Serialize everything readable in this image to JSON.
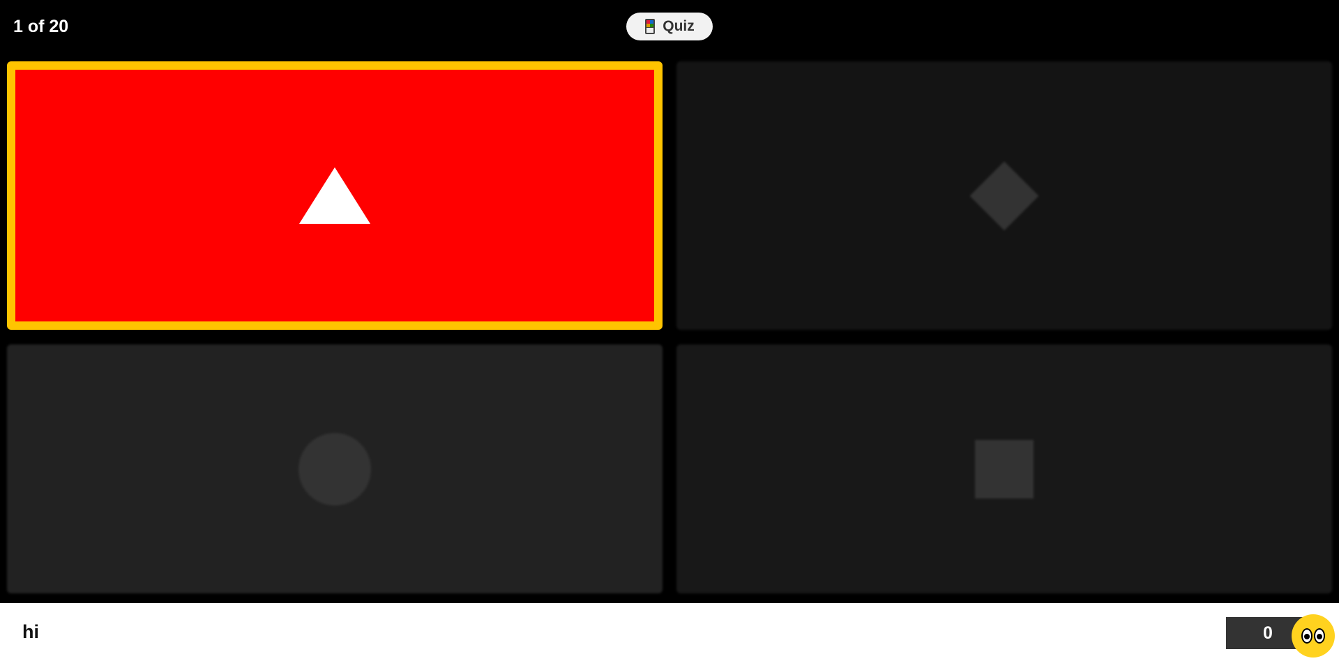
{
  "header": {
    "progress": "1 of 20",
    "mode_label": "Quiz",
    "mode_icon": "quiz-cards-icon"
  },
  "answers": [
    {
      "shape": "triangle",
      "color": "#ff0000",
      "selected": true,
      "border_color": "#ffc400"
    },
    {
      "shape": "diamond",
      "color": "#141414",
      "selected": false
    },
    {
      "shape": "circle",
      "color": "#222222",
      "selected": false
    },
    {
      "shape": "square",
      "color": "#181818",
      "selected": false
    }
  ],
  "footer": {
    "player_name": "hi",
    "score": "0",
    "avatar_icon": "googly-eyes-avatar-icon"
  }
}
